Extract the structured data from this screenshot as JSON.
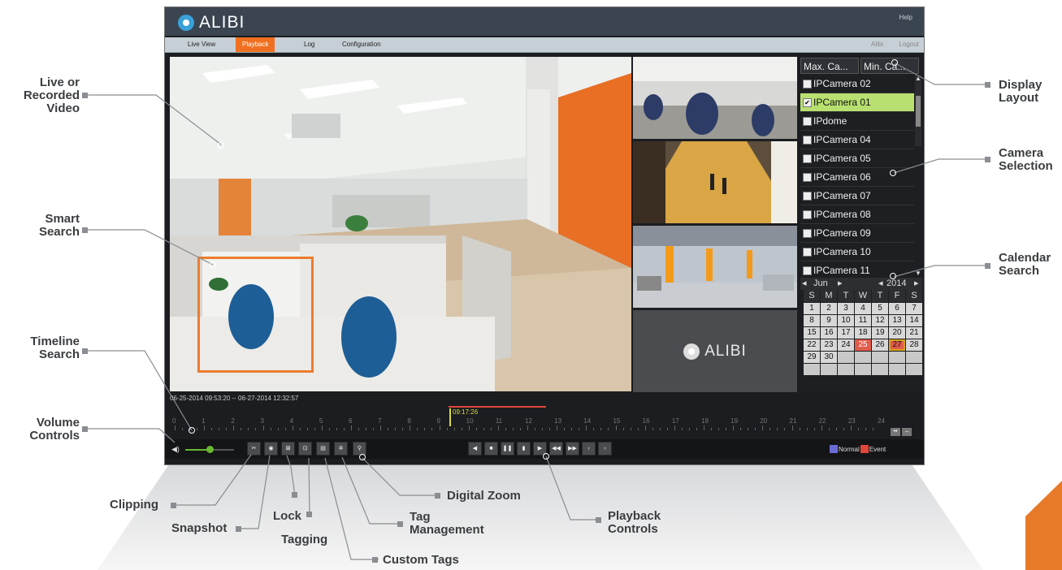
{
  "app": {
    "brand": "ALIBI",
    "help_label": "Help",
    "menu": [
      "Live View",
      "Playback",
      "Log",
      "Configuration"
    ],
    "active_menu": "Playback",
    "user": "Alibi",
    "logout_label": "Logout"
  },
  "layout": {
    "max_cameras": "Max. Ca...",
    "min_cameras": "Min. Ca..."
  },
  "cameras": [
    {
      "name": "IPCamera 02",
      "checked": false
    },
    {
      "name": "IPCamera 01",
      "checked": true
    },
    {
      "name": "IPdome",
      "checked": false
    },
    {
      "name": "IPCamera 04",
      "checked": false
    },
    {
      "name": "IPCamera 05",
      "checked": false
    },
    {
      "name": "IPCamera 06",
      "checked": false
    },
    {
      "name": "IPCamera 07",
      "checked": false
    },
    {
      "name": "IPCamera 08",
      "checked": false
    },
    {
      "name": "IPCamera 09",
      "checked": false
    },
    {
      "name": "IPCamera 10",
      "checked": false
    },
    {
      "name": "IPCamera 11",
      "checked": false
    }
  ],
  "calendar": {
    "month": "Jun",
    "year": "2014",
    "weekdays": [
      "S",
      "M",
      "T",
      "W",
      "T",
      "F",
      "S"
    ],
    "weeks": [
      [
        "1",
        "2",
        "3",
        "4",
        "5",
        "6",
        "7"
      ],
      [
        "8",
        "9",
        "10",
        "11",
        "12",
        "13",
        "14"
      ],
      [
        "15",
        "16",
        "17",
        "18",
        "19",
        "20",
        "21"
      ],
      [
        "22",
        "23",
        "24",
        "25",
        "26",
        "27",
        "28"
      ],
      [
        "29",
        "30",
        "",
        "",
        "",
        "",
        ""
      ],
      [
        "",
        "",
        "",
        "",
        "",
        "",
        ""
      ]
    ],
    "event_days": [
      "25",
      "27"
    ],
    "selected_day": "27"
  },
  "timeline": {
    "range": "06-25-2014 09:53:20 -- 06-27-2014 12:32:57",
    "hours": [
      "0",
      "1",
      "2",
      "3",
      "4",
      "5",
      "6",
      "7",
      "8",
      "9",
      "10",
      "11",
      "12",
      "13",
      "14",
      "15",
      "16",
      "17",
      "18",
      "19",
      "20",
      "21",
      "22",
      "23",
      "24"
    ],
    "current_time": "09:17:26"
  },
  "legend": {
    "normal_label": "Normal",
    "event_label": "Event",
    "normal_color": "#6b6bd8",
    "event_color": "#e1463a"
  },
  "callouts": {
    "live_video": [
      "Live or",
      "Recorded",
      "Video"
    ],
    "smart_search": [
      "Smart",
      "Search"
    ],
    "timeline_search": [
      "Timeline",
      "Search"
    ],
    "volume_controls": [
      "Volume",
      "Controls"
    ],
    "display_layout": [
      "Display",
      "Layout"
    ],
    "camera_selection": [
      "Camera",
      "Selection"
    ],
    "calendar_search": [
      "Calendar",
      "Search"
    ],
    "clipping": "Clipping",
    "snapshot": "Snapshot",
    "lock": "Lock",
    "tagging": "Tagging",
    "custom_tags": "Custom Tags",
    "tag_management": [
      "Tag",
      "Management"
    ],
    "digital_zoom": "Digital Zoom",
    "playback_controls": [
      "Playback",
      "Controls"
    ]
  },
  "colors": {
    "accent": "#f07020",
    "selected_camera": "#b8e070"
  }
}
